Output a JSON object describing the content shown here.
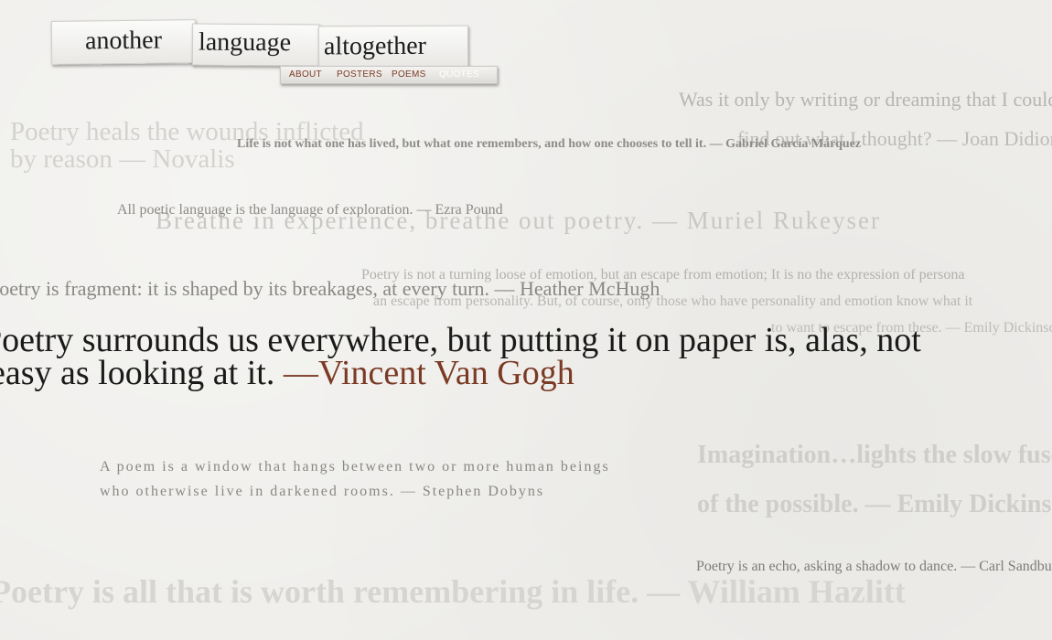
{
  "logo": {
    "word1": "another",
    "word2": "language",
    "word3": "altogether"
  },
  "nav": {
    "items": [
      "ABOUT",
      "POSTERS",
      "POEMS",
      "QUOTES"
    ],
    "active": "QUOTES"
  },
  "quotes": {
    "didion_1": "Was it only by writing or dreaming that I could",
    "didion_2": "find out what I thought? — Joan Didion",
    "novalis_1": "Poetry heals the wounds inflicted",
    "novalis_2": "by reason — Novalis",
    "marquez": "Life is not what one has lived, but what one remembers, and how one chooses to tell it. — Gabriel García Márquez",
    "pound": "All poetic language is the language of exploration. — Ezra Pound",
    "rukeyser": "Breathe in experience, breathe out poetry. — Muriel Rukeyser",
    "mchugh": "Poetry is fragment: it is shaped by its breakages, at every turn. — Heather McHugh",
    "eliot_1": "Poetry is not a turning loose of emotion, but an escape from emotion; It is no the expression of persona",
    "eliot_2": "an escape from personality. But, of course, only those who have personality and emotion know what it",
    "eliot_3": "to want to escape from these. — Emily Dickinson",
    "vangogh_1": "Poetry surrounds us everywhere, but putting it on paper is, alas, not",
    "vangogh_2": "easy as looking at it.",
    "vangogh_author": "—Vincent Van Gogh",
    "dobyns_1": "A poem is a window that hangs between two or more human beings",
    "dobyns_2": "who otherwise live in darkened rooms. — Stephen Dobyns",
    "dickinson_1": "Imagination…lights the slow fuse",
    "dickinson_2": "of the possible. — Emily Dickinson",
    "sandburg": "Poetry is an echo, asking a shadow to dance. — Carl Sandburg",
    "hazlitt": "Poetry is all that is worth remembering in life. — William Hazlitt"
  },
  "colors": {
    "background": "#efeeeb",
    "accent": "#7a3a24",
    "featured_text": "#1a1a1a"
  }
}
